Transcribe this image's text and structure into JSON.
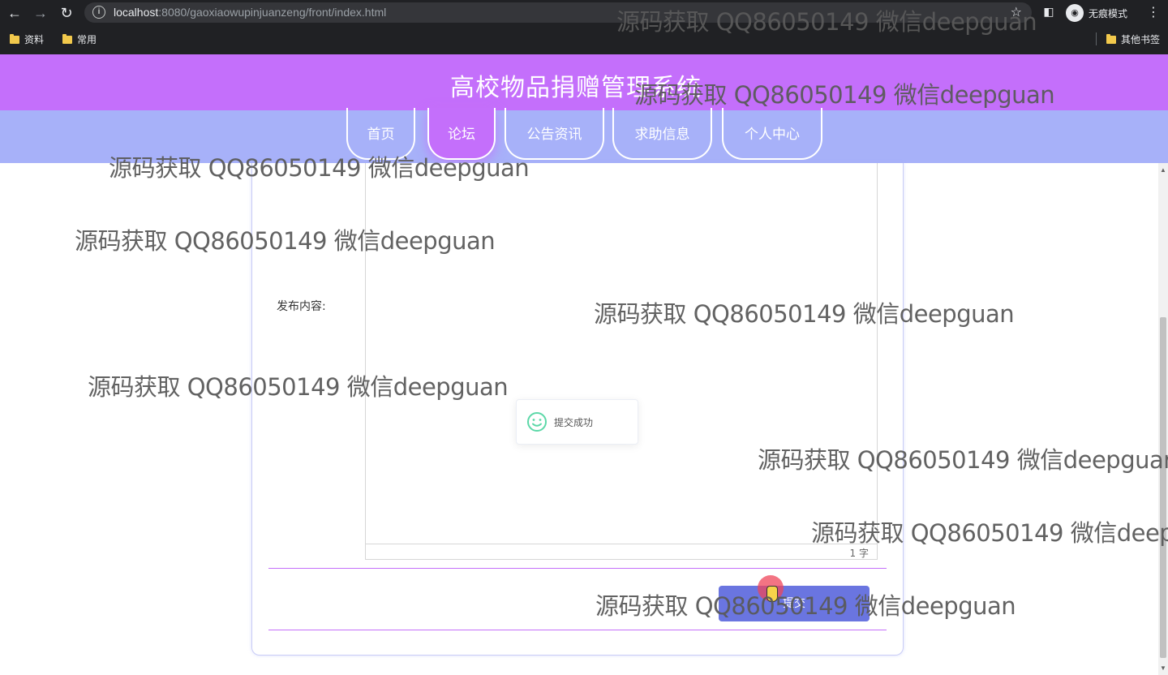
{
  "browser": {
    "url_host": "localhost",
    "url_path": ":8080/gaoxiaowupinjuanzeng/front/index.html",
    "incognito_label": "无痕模式",
    "bookmarks": [
      "资料",
      "常用"
    ],
    "other_bookmarks": "其他书签"
  },
  "site": {
    "title": "高校物品捐赠管理系统",
    "nav": [
      {
        "label": "首页",
        "active": false
      },
      {
        "label": "论坛",
        "active": true
      },
      {
        "label": "公告资讯",
        "active": false
      },
      {
        "label": "求助信息",
        "active": false
      },
      {
        "label": "个人中心",
        "active": false
      }
    ]
  },
  "form": {
    "content_label": "发布内容:",
    "char_count": "1 字",
    "submit_label": "提交"
  },
  "toast": {
    "message": "提交成功"
  },
  "watermark": "源码获取 QQ86050149 微信deepguan",
  "colors": {
    "header": "#c46ffb",
    "nav": "#a7b1f9",
    "button": "#6a75e0",
    "toast_icon": "#5cd8a8"
  }
}
